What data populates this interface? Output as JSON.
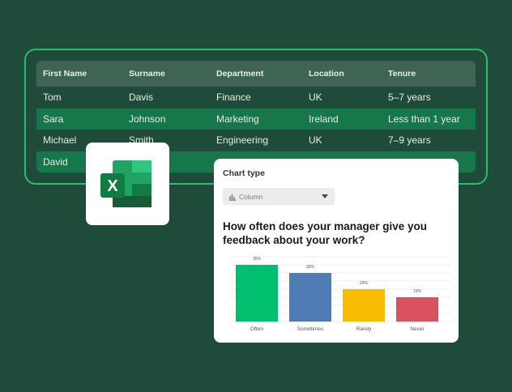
{
  "table": {
    "headers": [
      "First Name",
      "Surname",
      "Department",
      "Location",
      "Tenure"
    ],
    "rows": [
      [
        "Tom",
        "Davis",
        "Finance",
        "UK",
        "5–7 years"
      ],
      [
        "Sara",
        "Johnson",
        "Marketing",
        "Ireland",
        "Less than 1 year"
      ],
      [
        "Michael",
        "Smith",
        "Engineering",
        "UK",
        "7–9 years"
      ],
      [
        "David",
        "",
        "",
        "",
        ""
      ]
    ]
  },
  "excel_icon": {
    "letter": "X"
  },
  "chart_panel": {
    "label": "Chart type",
    "select_value": "Column",
    "select_icon": "bar-chart-icon",
    "question": "How often does your manager give you feedback about your work?"
  },
  "chart_data": {
    "type": "bar",
    "categories": [
      "Often",
      "Sometimes",
      "Rarely",
      "Never"
    ],
    "values": [
      35,
      30,
      20,
      15
    ],
    "data_labels": [
      "35%",
      "30%",
      "20%",
      "15%"
    ],
    "colors": [
      "#00bf6f",
      "#507cb6",
      "#f9be00",
      "#d9525f"
    ],
    "ylim": [
      0,
      40
    ],
    "grid": true
  }
}
